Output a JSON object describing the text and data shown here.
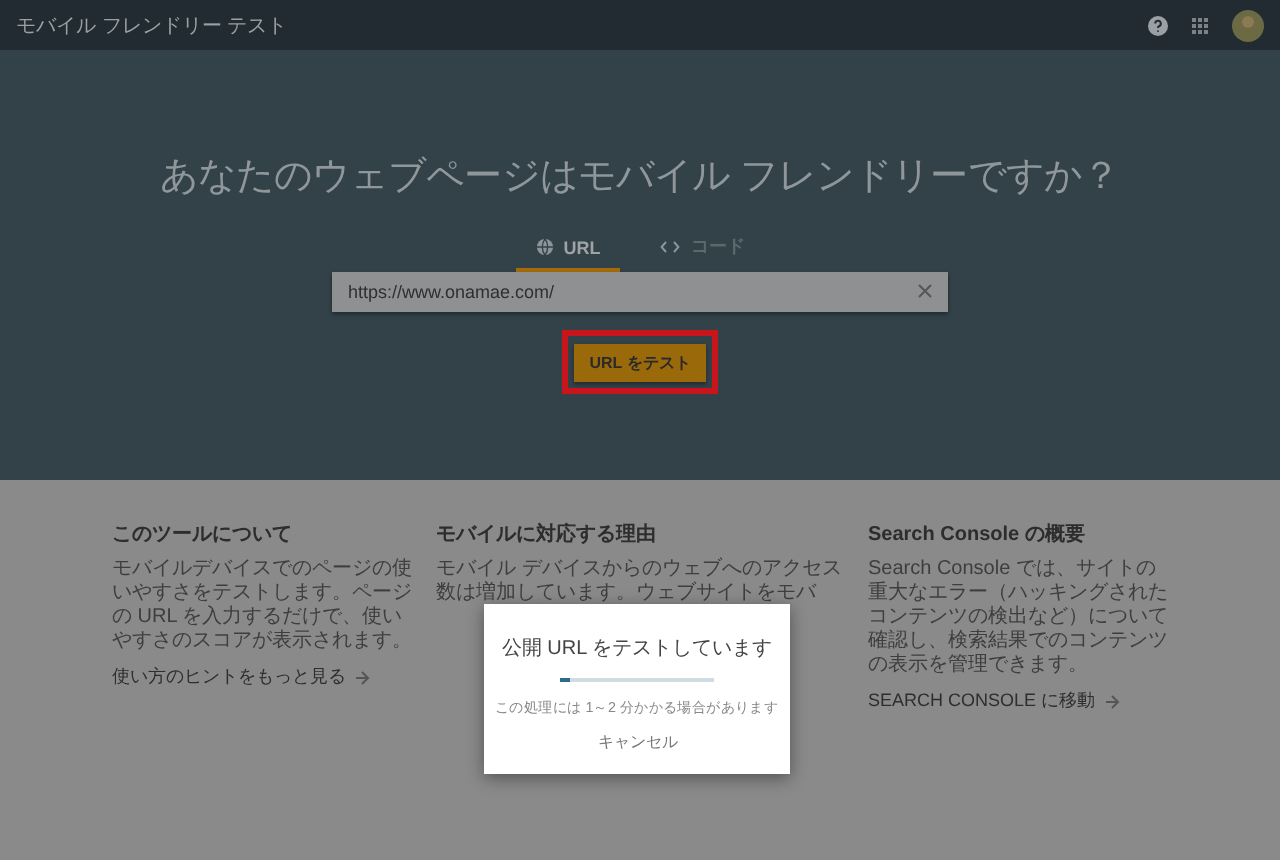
{
  "header": {
    "title": "モバイル フレンドリー テスト"
  },
  "hero": {
    "heading": "あなたのウェブページはモバイル フレンドリーですか？",
    "tabs": [
      {
        "label": "URL",
        "kind": "globe",
        "selected": true
      },
      {
        "label": "コード",
        "kind": "code",
        "selected": false
      }
    ],
    "url_field": {
      "value": "https://www.onamae.com/"
    },
    "test_button": {
      "label": "URL をテスト",
      "highlighted": true
    }
  },
  "columns": [
    {
      "title": "このツールについて",
      "body": "モバイルデバイスでのページの使いやすさをテストします。ページの URL を入力するだけで、使いやすさのスコアが表示されます。",
      "link": "使い方のヒントをもっと見る"
    },
    {
      "title": "モバイルに対応する理由",
      "body": "モバイル デバイスからのウェブへのアクセス数は増加しています。ウェブサイトをモバ"
    },
    {
      "title": "Search Console の概要",
      "body": "Search Console では、サイトの重大なエラー（ハッキングされたコンテンツの検出など）について確認し、検索結果でのコンテンツの表示を管理できます。",
      "link": "SEARCH CONSOLE に移動"
    }
  ],
  "dialog": {
    "title": "公開 URL をテストしています",
    "level": 0.07,
    "note": "この処理には 1～2 分かかる場合があります",
    "cancel": "キャンセル"
  }
}
